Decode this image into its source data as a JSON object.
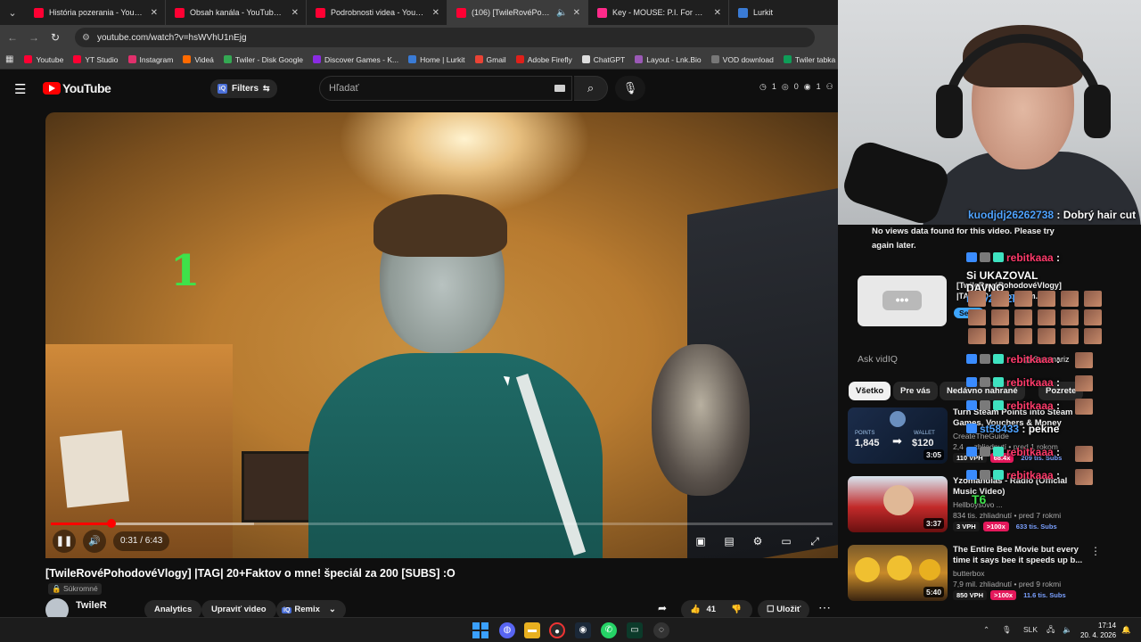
{
  "browser": {
    "tabs": [
      {
        "title": "História pozerania - YouTube",
        "active": false,
        "color": "#ff0033"
      },
      {
        "title": "Obsah kanála - YouTube Studio",
        "active": false,
        "color": "#ff0033"
      },
      {
        "title": "Podrobnosti videa - YouTube S",
        "active": false,
        "color": "#ff0033"
      },
      {
        "title": "(106) [TwileRovéPohodové\\",
        "active": true,
        "color": "#ff0033"
      },
      {
        "title": "Key - MOUSE: P.I. For Hire - Key",
        "active": false,
        "color": "#ff2a8a"
      },
      {
        "title": "Lurkit",
        "active": false,
        "color": "#3a7bd5"
      }
    ],
    "url": "youtube.com/watch?v=hsWVhU1nEjg",
    "bookmarks": [
      {
        "label": "Youtube",
        "color": "#ff0033"
      },
      {
        "label": "YT Studio",
        "color": "#ff0033"
      },
      {
        "label": "Instagram",
        "color": "#e1306c"
      },
      {
        "label": "Videá",
        "color": "#ff6a00"
      },
      {
        "label": "Twiler - Disk Google",
        "color": "#34a853"
      },
      {
        "label": "Discover Games - K...",
        "color": "#8a2be2"
      },
      {
        "label": "Home | Lurkit",
        "color": "#3a7bd5"
      },
      {
        "label": "Gmail",
        "color": "#ea4335"
      },
      {
        "label": "Adobe Firefly",
        "color": "#e0201a"
      },
      {
        "label": "ChatGPT",
        "color": "#dddddd"
      },
      {
        "label": "Layout - Lnk.Bio",
        "color": "#9b59b6"
      },
      {
        "label": "VOD download",
        "color": "#777777"
      },
      {
        "label": "Twiler tabka",
        "color": "#0f9d58"
      }
    ]
  },
  "youtube": {
    "logo_text": "YouTube",
    "filters_label": "Filters",
    "search_placeholder": "Hľadať",
    "stats": {
      "a": "1",
      "b": "0",
      "c": "1",
      "d": "48"
    }
  },
  "video": {
    "overlay_digit": "1",
    "time": "0:31 / 6:43",
    "progress_fraction": 0.078,
    "buffer_fraction": 0.26,
    "title": "[TwileRovéPohodovéVlogy] |TAG| 20+Faktov o mne! špeciál za 200 [SUBS] :O",
    "privacy": "Súkromné",
    "channel": "TwileR",
    "analytics_label": "Analytics",
    "edit_label": "Upraviť video",
    "remix_label": "Remix",
    "likes": "41",
    "save_label": "Uložiť"
  },
  "sidebar": {
    "no_views": "No views data found for this video. Please try again later.",
    "card_title": "[TwileRovéPohodovéVlogy] |TAG| 20+Faktov o m...",
    "card_button": "See...",
    "ask_placeholder": "Ask vidIQ",
    "summarize_label": "Summariz",
    "chips": [
      "Všetko",
      "Pre vás",
      "Nedávno nahrané",
      "Pozrete"
    ],
    "recommendations": [
      {
        "title": "Turn Steam Points into Steam Games, Vouchers & Money",
        "channel": "CreateTheGuide",
        "meta": "2,4 ... zhliadnutí • pred 1 rokom",
        "duration": "3:05",
        "vph": "110 VPH",
        "pct": "68.4x",
        "subs": "209 tis. Subs",
        "thumb_points_label": "POINTS",
        "thumb_points": "1,845",
        "thumb_wallet_label": "WALLET",
        "thumb_wallet": "$120"
      },
      {
        "title": "Yzomandias - Rádio (Official Music Video)",
        "channel": "Hellboysovo ...",
        "meta": "834 tis. zhliadnutí • pred 7 rokmi",
        "duration": "3:37",
        "vph": "3 VPH",
        "pct": ">100x",
        "subs": "633 tis. Subs"
      },
      {
        "title": "The Entire Bee Movie but every time it says bee it speeds up b...",
        "channel": "butterbox",
        "meta": "7,9 mil. zhliadnutí • pred 9 rokmi",
        "duration": "5:40",
        "vph": "850 VPH",
        "pct": ">100x",
        "subs": "11.6 tis. Subs"
      }
    ]
  },
  "chat": [
    {
      "name": "kuodjdj26262738",
      "message": "Dobrý hair cut",
      "color": "#4fa3ff"
    },
    {
      "name": "rebitkaaa",
      "message": "Si UKAZOVAL DAVNO",
      "color": "#ff3b6b"
    },
    {
      "name": "naty2012k",
      "message": "",
      "color": "#4fa3ff"
    },
    {
      "name": "rebitkaaa",
      "message": "",
      "color": "#ff3b6b"
    },
    {
      "name": "rebitkaaa",
      "message": "",
      "color": "#ff3b6b"
    },
    {
      "name": "rebitkaaa",
      "message": "",
      "color": "#ff3b6b"
    },
    {
      "name": "st58433",
      "message": "pekne",
      "color": "#4fa3ff"
    },
    {
      "name": "rebitkaaa",
      "message": "",
      "color": "#ff3b6b"
    },
    {
      "name": "rebitkaaa",
      "message": "",
      "color": "#ff3b6b"
    },
    {
      "name": "T6",
      "message": "",
      "color": "#3ee24a"
    }
  ],
  "taskbar": {
    "lang": "SLK",
    "time": "17:14",
    "date": "20. 4. 2026"
  }
}
